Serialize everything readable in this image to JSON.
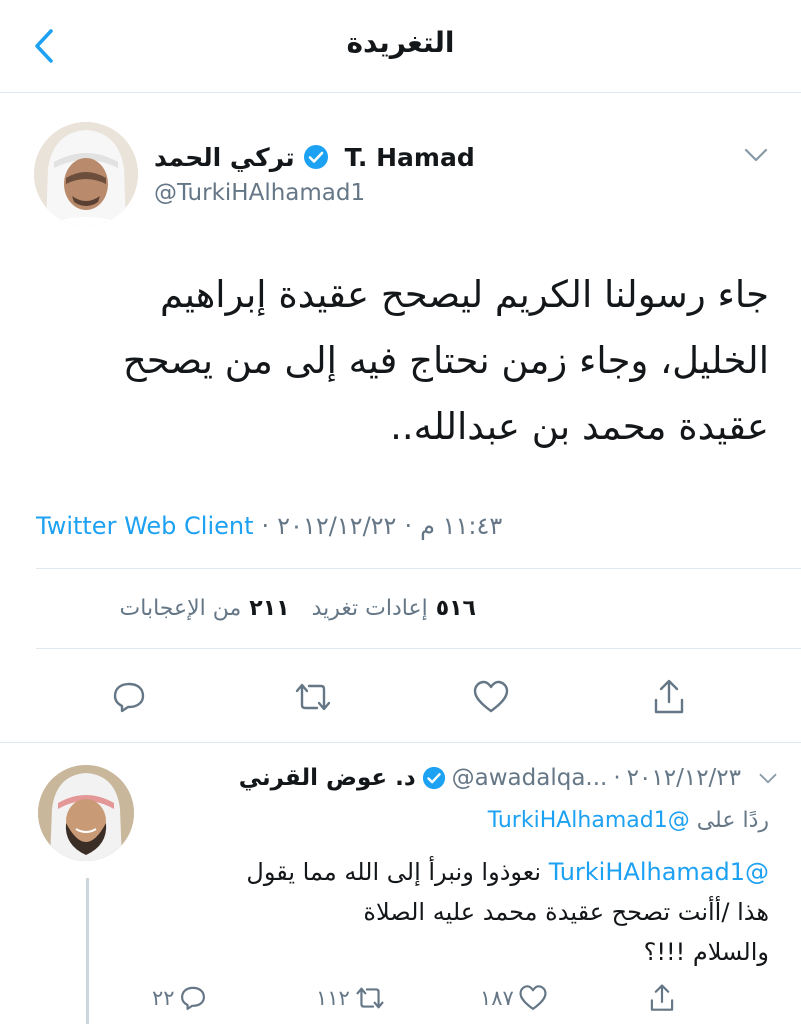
{
  "header": {
    "title": "التغريدة"
  },
  "tweet": {
    "display_name_ar": "تركي الحمد",
    "display_name_en": "T. Hamad",
    "handle": "@TurkiHAlhamad1",
    "lines": [
      "جاء رسولنا الكريم ليصحح عقيدة إبراهيم",
      "الخليل، وجاء زمن نحتاج فيه إلى من يصحح",
      "عقيدة محمد بن عبدالله.."
    ],
    "time": "١١:٤٣ م",
    "date": "٢٠١٢/١٢/٢٢",
    "client": "Twitter Web Client",
    "separator": "·",
    "retweets_count": "٥١٦",
    "retweets_label": "إعادات تغريد",
    "likes_count": "٢١١",
    "likes_label": "من الإعجابات"
  },
  "reply": {
    "display_name": "د. عوض القرني",
    "handle": "@awadalqa...",
    "date": "٢٠١٢/١٢/٢٣",
    "separator": "·",
    "replying_label": "ردًا على",
    "replying_to": "@TurkiHAlhamad1",
    "mention": "@TurkiHAlhamad1",
    "line1_rest": "نعوذوا ونبرأ إلى الله مما يقول",
    "line2": "هذا /أأنت تصحح عقيدة محمد عليه الصلاة",
    "line3": "والسلام !!!؟",
    "reply_count": "٢٢",
    "retweet_count": "١١٢",
    "like_count": "١٨٧"
  },
  "icons": {
    "back": "chevron-left-icon",
    "verified": "verified-badge-icon",
    "more": "chevron-down-icon",
    "reply": "comment-icon",
    "retweet": "retweet-icon",
    "like": "heart-icon",
    "share": "share-icon"
  },
  "colors": {
    "accent": "#1da1f2",
    "secondary_text": "#657786",
    "primary_text": "#14171a",
    "divider": "#e1e8ed"
  }
}
